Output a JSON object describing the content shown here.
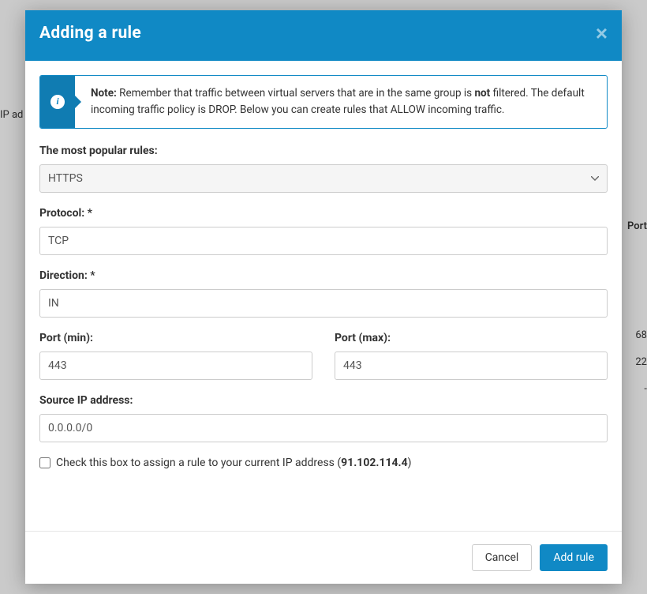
{
  "background": {
    "left_snip": "IP ad",
    "right_head": "Port",
    "right_vals": [
      "68",
      "22",
      "-"
    ]
  },
  "modal": {
    "title": "Adding a rule",
    "note_label": "Note:",
    "note_text_before": " Remember that traffic between virtual servers that are in the same group is ",
    "note_bold": "not",
    "note_text_after": " filtered. The default incoming traffic policy is DROP. Below you can create rules that ALLOW incoming traffic.",
    "labels": {
      "popular": "The most popular rules:",
      "protocol": "Protocol: *",
      "direction": "Direction: *",
      "port_min": "Port (min):",
      "port_max": "Port (max):",
      "source_ip": "Source IP address:"
    },
    "values": {
      "popular": "HTTPS",
      "protocol": "TCP",
      "direction": "IN",
      "port_min": "443",
      "port_max": "443",
      "source_ip": "0.0.0.0/0"
    },
    "checkbox": {
      "label_before": "Check this box to assign a rule to your current IP address (",
      "ip": "91.102.114.4",
      "label_after": ")"
    },
    "buttons": {
      "cancel": "Cancel",
      "add": "Add rule"
    }
  }
}
